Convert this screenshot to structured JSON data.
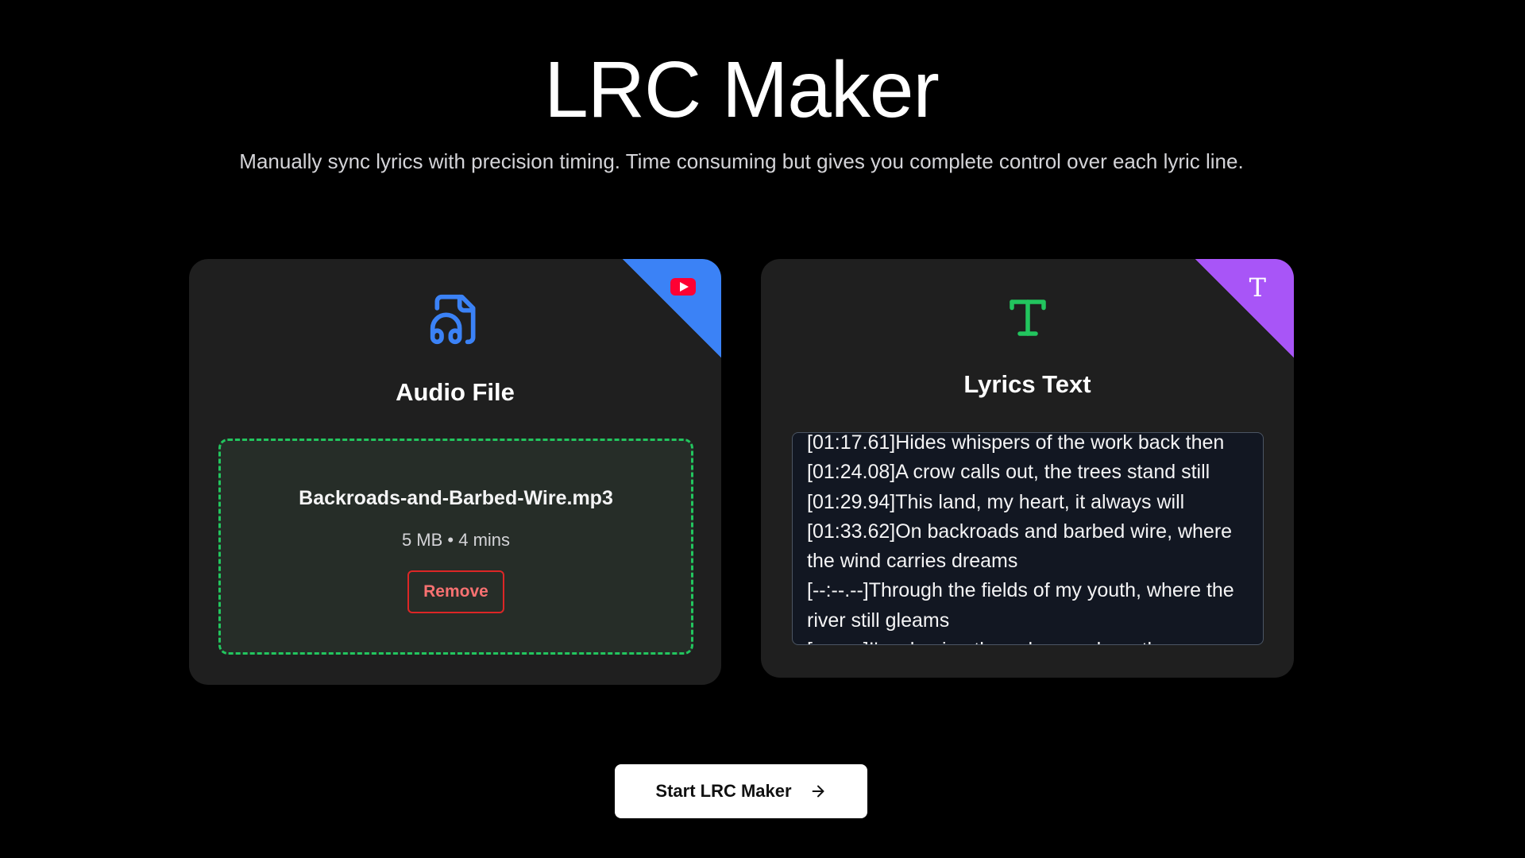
{
  "header": {
    "title": "LRC Maker",
    "subtitle": "Manually sync lyrics with precision timing. Time consuming but gives you complete control over each lyric line."
  },
  "audio_card": {
    "title": "Audio File",
    "icon": "file-audio-icon",
    "corner_icon": "youtube-icon",
    "file_name": "Backroads-and-Barbed-Wire.mp3",
    "file_meta": "5 MB • 4 mins",
    "remove_label": "Remove"
  },
  "lyrics_card": {
    "title": "Lyrics Text",
    "icon": "text-icon",
    "corner_icon": "text-icon",
    "lines": [
      "[01:17.61]Hides whispers of the work back then",
      "[01:24.08]A crow calls out, the trees stand still",
      "[01:29.94]This land, my heart, it always will",
      "[01:33.62]On backroads and barbed wire, where the wind carries dreams",
      "[--:--.--]Through the fields of my youth, where the river still gleams",
      "[--:--.--]I'm chasing the echoes, where the"
    ]
  },
  "actions": {
    "start_label": "Start LRC Maker"
  },
  "colors": {
    "background": "#000000",
    "card": "#1f1f1f",
    "audio_accent": "#3b82f6",
    "lyrics_accent": "#a855f7",
    "text_icon": "#22c55e",
    "dropzone_border": "#22c55e",
    "remove": "#dc2626"
  }
}
